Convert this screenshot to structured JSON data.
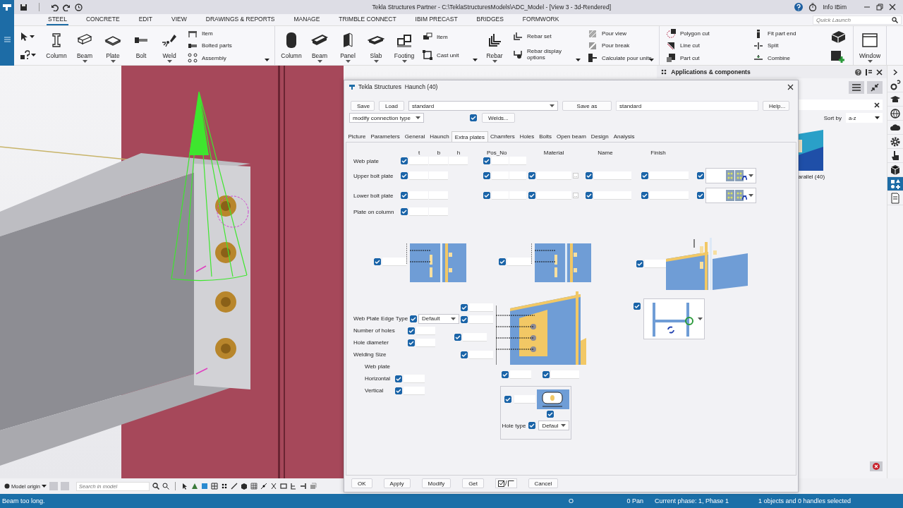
{
  "title_bar": {
    "title": "Tekla Structures Partner - C:\\TeklaStructuresModels\\ADC_Model  - [View 3 - 3d-Rendered]",
    "user": "Info IBim"
  },
  "menu": {
    "tabs": [
      {
        "label": "STEEL",
        "selected": true
      },
      {
        "label": "CONCRETE",
        "selected": false
      },
      {
        "label": "EDIT",
        "selected": false
      },
      {
        "label": "VIEW",
        "selected": false
      },
      {
        "label": "DRAWINGS & REPORTS",
        "selected": false
      },
      {
        "label": "MANAGE",
        "selected": false
      },
      {
        "label": "TRIMBLE CONNECT",
        "selected": false
      },
      {
        "label": "IBIM PRECAST",
        "selected": false
      },
      {
        "label": "BRIDGES",
        "selected": false
      },
      {
        "label": "FORMWORK",
        "selected": false
      }
    ],
    "quick_launch": {
      "placeholder": "Quick Launch"
    }
  },
  "ribbon": {
    "groups": [
      {
        "tools": [
          {
            "kind": "pickers"
          },
          {
            "kind": "big",
            "label": "Column",
            "dropdown": false
          },
          {
            "kind": "big",
            "label": "Beam",
            "dropdown": true
          },
          {
            "kind": "big",
            "label": "Plate",
            "dropdown": true
          },
          {
            "kind": "big",
            "label": "Bolt",
            "dropdown": false
          },
          {
            "kind": "big",
            "label": "Weld",
            "dropdown": true
          },
          {
            "kind": "stack",
            "items": [
              "Item",
              "Bolted parts",
              "Assembly"
            ],
            "dropdown": true
          }
        ]
      },
      {
        "tools": [
          {
            "kind": "big",
            "label": "Column",
            "dropdown": false
          },
          {
            "kind": "big",
            "label": "Beam",
            "dropdown": true
          },
          {
            "kind": "big",
            "label": "Panel",
            "dropdown": true
          },
          {
            "kind": "big",
            "label": "Slab",
            "dropdown": true
          },
          {
            "kind": "big",
            "label": "Footing",
            "dropdown": true
          },
          {
            "kind": "stack",
            "items": [
              "Item",
              "Cast unit"
            ],
            "dropdown": true
          },
          {
            "kind": "big",
            "label": "Rebar",
            "dropdown": true
          },
          {
            "kind": "stack",
            "items": [
              "Rebar set",
              "Rebar display options"
            ],
            "dropdown": true
          },
          {
            "kind": "stack",
            "items": [
              "Pour view",
              "Pour break",
              "Calculate pour units"
            ],
            "dropdown": true
          }
        ]
      },
      {
        "tools": [
          {
            "kind": "stack",
            "items": [
              "Polygon cut",
              "Line cut",
              "Part cut"
            ],
            "dropdown": false
          },
          {
            "kind": "stack",
            "items": [
              "Fit part end",
              "Split",
              "Combine"
            ],
            "dropdown": false
          },
          {
            "kind": "icons"
          }
        ]
      },
      {
        "tools": [
          {
            "kind": "big",
            "label": "Window",
            "dropdown": true
          }
        ]
      }
    ]
  },
  "dialog": {
    "title": "Tekla Structures  Haunch (40)",
    "toolbar": {
      "save": "Save",
      "load": "Load",
      "attribute_file": "standard",
      "save_as": "Save as",
      "save_as_name": "standard",
      "help": "Help..."
    },
    "connection_type": "modify connection type",
    "welds": {
      "checked": true,
      "label": "Welds..."
    },
    "tabs": [
      {
        "label": "Picture",
        "selected": false
      },
      {
        "label": "Parameters",
        "selected": false
      },
      {
        "label": "General",
        "selected": false
      },
      {
        "label": "Haunch",
        "selected": false
      },
      {
        "label": "Extra plates",
        "selected": true
      },
      {
        "label": "Chamfers",
        "selected": false
      },
      {
        "label": "Holes",
        "selected": false
      },
      {
        "label": "Bolts",
        "selected": false
      },
      {
        "label": "Open beam",
        "selected": false
      },
      {
        "label": "Design",
        "selected": false
      },
      {
        "label": "Analysis",
        "selected": false
      }
    ],
    "plate_table": {
      "columns": [
        "t",
        "b",
        "h",
        "Pos_No",
        "Material",
        "Name",
        "Finish"
      ],
      "rows": [
        {
          "kind": "webplate",
          "label": "Web plate",
          "checked": true
        },
        {
          "kind": "boltplate",
          "label": "Upper bolt plate",
          "checked": true,
          "browse": "..."
        },
        {
          "kind": "boltplate",
          "label": "Lower bolt plate",
          "checked": true,
          "browse": "..."
        },
        {
          "kind": "sizeonly",
          "label": "Plate on column",
          "checked": true
        }
      ]
    },
    "details": [
      {
        "kind": "gap",
        "checked": true
      },
      {
        "kind": "gap",
        "checked": true
      },
      {
        "kind": "offset",
        "checked": true
      }
    ],
    "edge_type": {
      "label": "Web Plate Edge Type",
      "checked": true,
      "value": "Default"
    },
    "holes": [
      {
        "label": "Number of holes",
        "checked": true
      },
      {
        "label": "Hole diameter",
        "checked": true
      }
    ],
    "welding": {
      "title": "Welding Size",
      "subtitle": "Web plate",
      "rows": [
        {
          "label": "Horizontal",
          "checked": true
        },
        {
          "label": "Vertical",
          "checked": true
        }
      ]
    },
    "web_plate_detail": {
      "side_inputs": [
        {
          "checked": true
        },
        {
          "checked": true
        },
        {
          "checked": true
        },
        {
          "checked": true
        }
      ],
      "bottom_inputs": [
        {
          "checked": true
        },
        {
          "checked": true
        }
      ]
    },
    "profile_picker": {
      "checked": true
    },
    "hole_detail": {
      "inputs": [
        {
          "checked": true
        },
        {
          "checked": true
        }
      ],
      "hole_type": {
        "label": "Hole type",
        "checked": true,
        "value": "Defaul"
      }
    },
    "buttons": {
      "ok": "OK",
      "apply": "Apply",
      "modify": "Modify",
      "get": "Get",
      "toggle_separator": "/",
      "cancel": "Cancel"
    }
  },
  "panel": {
    "title": "Applications & components",
    "sort_label": "Sort by",
    "sort_value": "a-z",
    "item_label": "arallel (40)"
  },
  "side_tabs": [
    {
      "selected": false
    },
    {
      "selected": false
    },
    {
      "selected": false
    },
    {
      "selected": false
    },
    {
      "selected": false
    },
    {
      "selected": false
    },
    {
      "selected": false
    },
    {
      "selected": true
    },
    {
      "selected": false
    }
  ],
  "view_toolbar": {
    "origin": "Model origin",
    "search": {
      "placeholder": "Search in model"
    }
  },
  "status_bar": {
    "message": "Beam too long.",
    "indicator": "O",
    "pan": "0 Pan",
    "phase": "Current phase: 1, Phase 1",
    "selection": "1 objects and 0 handles selected"
  }
}
